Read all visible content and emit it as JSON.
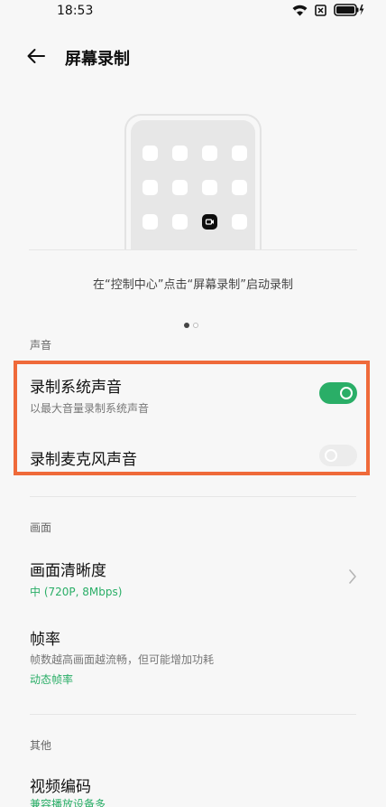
{
  "status_bar": {
    "time": "18:53",
    "icons": [
      "wifi-icon",
      "sim-icon",
      "battery-charging-icon"
    ]
  },
  "header": {
    "back_icon": "arrow-left-icon",
    "title": "屏幕录制"
  },
  "illustration": {
    "hint": "在“控制中心”点击“屏幕录制”启动录制",
    "pager": {
      "count": 2,
      "active_index": 0
    }
  },
  "sound": {
    "label": "声音",
    "system_sound": {
      "title": "录制系统声音",
      "subtitle": "以最大音量录制系统声音",
      "enabled": true
    },
    "mic_sound": {
      "title": "录制麦克风声音",
      "enabled": false
    }
  },
  "picture": {
    "label": "画面",
    "resolution": {
      "title": "画面清晰度",
      "value": "中 (720P, 8Mbps)"
    },
    "frame_rate": {
      "title": "帧率",
      "subtitle": "帧数越高画面越流畅，但可能增加功耗",
      "value": "动态帧率"
    }
  },
  "other": {
    "label": "其他",
    "video_encoding": {
      "title": "视频编码",
      "value": "兼容播放设备多"
    }
  },
  "colors": {
    "accent": "#2aae67",
    "highlight": "#ef6a3a"
  }
}
